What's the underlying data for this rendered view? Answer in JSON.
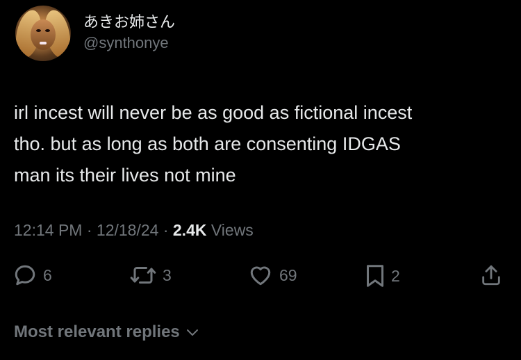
{
  "author": {
    "display_name": "あきお姉さん",
    "handle": "@synthonye",
    "avatar": "avatar-image"
  },
  "tweet": {
    "text": "irl incest will never be as good as fictional incest\ntho. but as long as both are consenting IDGAS\nman its their lives not mine",
    "time": "12:14 PM",
    "date": "12/18/24",
    "separator": "·",
    "views_count": "2.4K",
    "views_label": "Views"
  },
  "actions": {
    "replies": "6",
    "reposts": "3",
    "likes": "69",
    "bookmarks": "2"
  },
  "replies_filter": {
    "label": "Most relevant replies",
    "icon": "chevron-down-icon"
  },
  "colors": {
    "background": "#000000",
    "text": "#e7e9ea",
    "muted": "#71767b"
  }
}
